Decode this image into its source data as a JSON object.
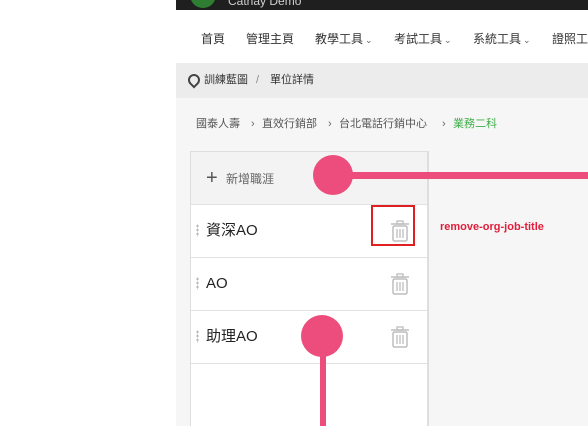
{
  "header": {
    "brand": "Cathay Demo"
  },
  "nav": {
    "items": [
      {
        "label": "首頁",
        "has_menu": false
      },
      {
        "label": "管理主頁",
        "has_menu": false
      },
      {
        "label": "教學工具",
        "has_menu": true
      },
      {
        "label": "考試工具",
        "has_menu": true
      },
      {
        "label": "系統工具",
        "has_menu": true
      },
      {
        "label": "證照工",
        "has_menu": false
      }
    ],
    "chevron": "⌄"
  },
  "breadcrumb": {
    "icon": "location-pin-icon",
    "items": [
      "訓練藍圖",
      "單位詳情"
    ],
    "separator": "/"
  },
  "org_path": {
    "items": [
      "國泰人壽",
      "直效行銷部",
      "台北電話行銷中心",
      "業務二科"
    ],
    "separator": "›",
    "active_color": "#3fae4a"
  },
  "job_titles": {
    "add_icon": "plus-icon",
    "add_label": "新增職涯",
    "items": [
      {
        "label": "資深AO",
        "delete_icon": "trash-icon"
      },
      {
        "label": "AO",
        "delete_icon": "trash-icon"
      },
      {
        "label": "助理AO",
        "delete_icon": "trash-icon"
      }
    ]
  },
  "annotation": {
    "label": "remove-org-job-title",
    "callout_color": "#e21d3a",
    "highlight_color": "#e02020",
    "marker_color": "#ec4d7d"
  }
}
